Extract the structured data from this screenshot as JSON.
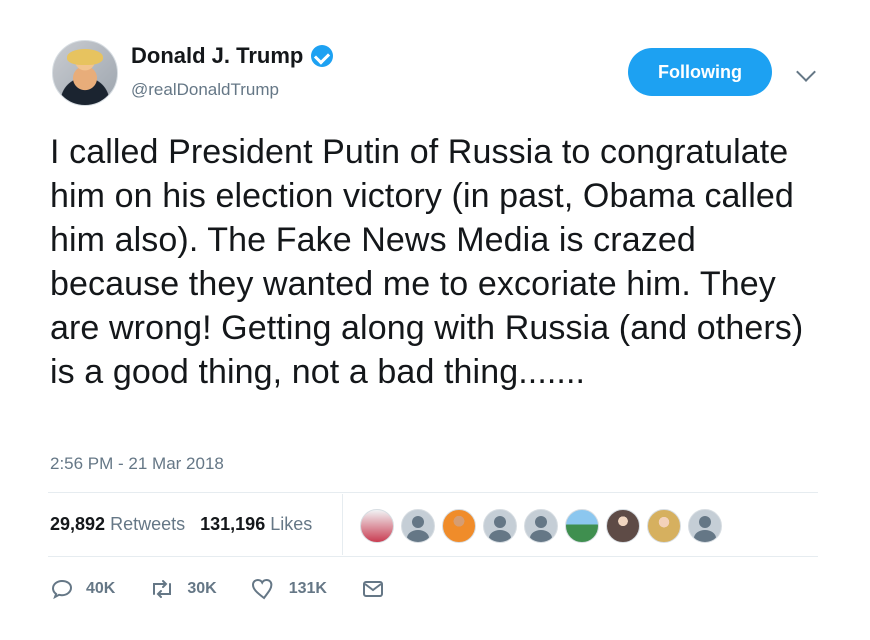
{
  "user": {
    "name": "Donald J. Trump",
    "handle": "@realDonaldTrump",
    "follow_label": "Following"
  },
  "tweet": {
    "text": "I called President Putin of Russia to congratulate him on his election victory (in past, Obama called him also). The Fake News Media is crazed because they wanted me to excoriate him. They are wrong! Getting along with Russia (and others) is a good thing, not a bad thing.......",
    "timestamp": "2:56 PM - 21 Mar 2018"
  },
  "stats": {
    "retweets_count": "29,892",
    "retweets_label": "Retweets",
    "likes_count": "131,196",
    "likes_label": "Likes"
  },
  "actions": {
    "reply": "40K",
    "retweet": "30K",
    "like": "131K"
  },
  "colors": {
    "accent": "#1da1f2",
    "muted": "#657786",
    "divider": "#e6ecf0"
  },
  "icons": [
    "verified-icon",
    "chevron-down-icon",
    "reply-icon",
    "retweet-icon",
    "like-icon",
    "message-icon"
  ]
}
